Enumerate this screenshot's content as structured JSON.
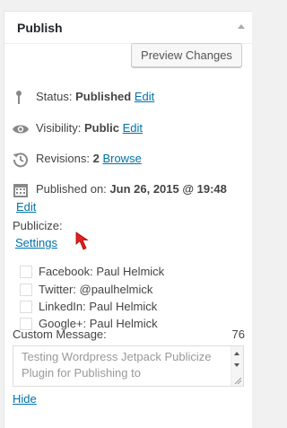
{
  "header": {
    "title": "Publish"
  },
  "preview_button": "Preview Changes",
  "status": {
    "label": "Status:",
    "value": "Published",
    "edit": "Edit"
  },
  "visibility": {
    "label": "Visibility:",
    "value": "Public",
    "edit": "Edit"
  },
  "revisions": {
    "label": "Revisions:",
    "value": "2",
    "link": "Browse"
  },
  "published_on": {
    "label": "Published on:",
    "value": "Jun 26, 2015 @ 19:48",
    "edit": "Edit"
  },
  "publicize": {
    "label": "Publicize:",
    "settings": "Settings",
    "services": [
      {
        "label": "Facebook: Paul Helmick"
      },
      {
        "label": "Twitter: @paulhelmick"
      },
      {
        "label": "LinkedIn: Paul Helmick"
      },
      {
        "label": "Google+: Paul Helmick"
      }
    ],
    "custom_message_label": "Custom Message:",
    "char_count": "76",
    "message_text": "Testing Wordpress Jetpack Publicize Plugin for Publishing to",
    "hide": "Hide"
  },
  "colors": {
    "link": "#0073aa",
    "cursor": "#e02020"
  }
}
